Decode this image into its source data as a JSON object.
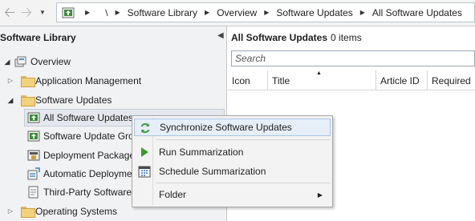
{
  "address_bar": {
    "root": "\\",
    "breadcrumbs": [
      "Software Library",
      "Overview",
      "Software Updates",
      "All Software Updates"
    ]
  },
  "left_pane": {
    "title": "Software Library",
    "tree": {
      "overview": "Overview",
      "application_management": "Application Management",
      "software_updates": "Software Updates",
      "all_software_updates": "All Software Updates",
      "software_update_groups": "Software Update Grou",
      "deployment_packages": "Deployment Packages",
      "automatic_deployment": "Automatic Deploymen",
      "third_party": "Third-Party Software U",
      "operating_systems": "Operating Systems"
    }
  },
  "content": {
    "title": "All Software Updates",
    "count": "0 items",
    "search_placeholder": "Search",
    "columns": [
      "Icon",
      "Title",
      "Article ID",
      "Required"
    ]
  },
  "context_menu": {
    "items": [
      {
        "label": "Synchronize Software Updates",
        "icon": "sync-icon"
      },
      {
        "label": "Run Summarization",
        "icon": "run-icon"
      },
      {
        "label": "Schedule Summarization",
        "icon": "schedule-icon"
      },
      {
        "label": "Folder",
        "icon": ""
      }
    ]
  },
  "colors": {
    "highlight": "#e6eef8",
    "pane_bg": "#f1f2f4",
    "folder": "#f2d27c",
    "run_green": "#3a9a2e",
    "sync_green": "#3d9b3f"
  }
}
